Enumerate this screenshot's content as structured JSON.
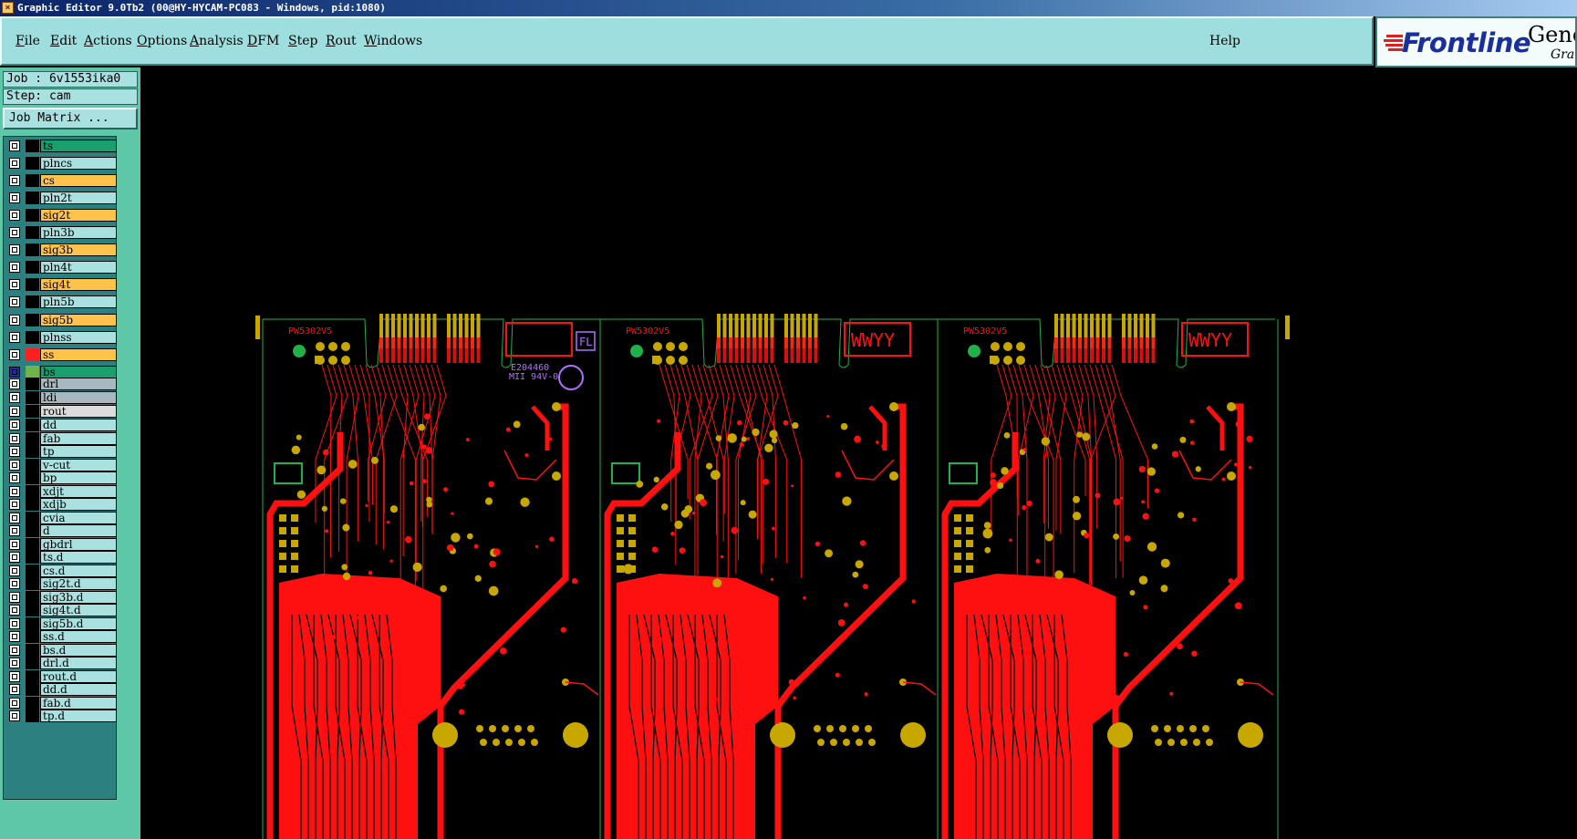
{
  "window": {
    "title": "Graphic Editor 9.0Tb2 (00@HY-HYCAM-PC083 - Windows, pid:1080)",
    "app_icon": "genesis-app-icon"
  },
  "menubar": {
    "items": [
      {
        "mnemonic": "F",
        "rest": "ile"
      },
      {
        "mnemonic": "E",
        "rest": "dit"
      },
      {
        "mnemonic": "A",
        "rest": "ctions"
      },
      {
        "mnemonic": "O",
        "rest": "ptions"
      },
      {
        "mnemonic": "A",
        "rest": "nalysis"
      },
      {
        "mnemonic": "D",
        "rest": "FM"
      },
      {
        "mnemonic": "S",
        "rest": "tep"
      },
      {
        "mnemonic": "R",
        "rest": "out"
      },
      {
        "mnemonic": "W",
        "rest": "indows"
      }
    ],
    "help": "Help"
  },
  "logo": {
    "brand": "Frontline",
    "product": "Gene",
    "subtitle": "Grap"
  },
  "job": {
    "job_label": "Job : 6v1553ika0",
    "step_label": "Step: cam",
    "job_matrix_button": "Job Matrix ..."
  },
  "layers": [
    {
      "name": "ts",
      "color": "#1aa06e",
      "swatch": "#000"
    },
    {
      "name": "plncs",
      "color": "#a9e0e0",
      "swatch": "#000"
    },
    {
      "name": "cs",
      "color": "#ffc24a",
      "swatch": "#000"
    },
    {
      "name": "pln2t",
      "color": "#a9e0e0",
      "swatch": "#000"
    },
    {
      "name": "sig2t",
      "color": "#ffc24a",
      "swatch": "#000"
    },
    {
      "name": "pln3b",
      "color": "#a9e0e0",
      "swatch": "#000"
    },
    {
      "name": "sig3b",
      "color": "#ffc24a",
      "swatch": "#000"
    },
    {
      "name": "pln4t",
      "color": "#a9e0e0",
      "swatch": "#000"
    },
    {
      "name": "sig4t",
      "color": "#ffc24a",
      "swatch": "#000"
    },
    {
      "name": "pln5b",
      "color": "#a9e0e0",
      "swatch": "#000"
    },
    {
      "name": "sig5b",
      "color": "#ffc24a",
      "swatch": "#000"
    },
    {
      "name": "plnss",
      "color": "#a9e0e0",
      "swatch": "#000"
    },
    {
      "name": "ss",
      "color": "#ffc24a",
      "swatch": "#ff2020"
    },
    {
      "name": "bs",
      "color": "#1aa06e",
      "swatch": "#6fb44a",
      "active": true
    },
    {
      "name": "drl",
      "color": "#a8b8c0",
      "swatch": "#000"
    },
    {
      "name": "ldi",
      "color": "#a8b8c0",
      "swatch": "#000"
    },
    {
      "name": "rout",
      "color": "#dcdcdc",
      "swatch": "#000"
    },
    {
      "name": "dd",
      "color": "#a9e0e0",
      "swatch": "#000"
    },
    {
      "name": "fab",
      "color": "#a9e0e0",
      "swatch": "#000"
    },
    {
      "name": "tp",
      "color": "#a9e0e0",
      "swatch": "#000"
    },
    {
      "name": "v-cut",
      "color": "#a9e0e0",
      "swatch": "#000"
    },
    {
      "name": "bp",
      "color": "#a9e0e0",
      "swatch": "#000"
    },
    {
      "name": "xdjt",
      "color": "#a9e0e0",
      "swatch": "#000"
    },
    {
      "name": "xdjb",
      "color": "#a9e0e0",
      "swatch": "#000"
    },
    {
      "name": "cvia",
      "color": "#a9e0e0",
      "swatch": "#000"
    },
    {
      "name": "d",
      "color": "#a9e0e0",
      "swatch": "#000"
    },
    {
      "name": "gbdrl",
      "color": "#a9e0e0",
      "swatch": "#000"
    },
    {
      "name": "ts.d",
      "color": "#a9e0e0",
      "swatch": "#000"
    },
    {
      "name": "cs.d",
      "color": "#a9e0e0",
      "swatch": "#000"
    },
    {
      "name": "sig2t.d",
      "color": "#a9e0e0",
      "swatch": "#000"
    },
    {
      "name": "sig3b.d",
      "color": "#a9e0e0",
      "swatch": "#000"
    },
    {
      "name": "sig4t.d",
      "color": "#a9e0e0",
      "swatch": "#000"
    },
    {
      "name": "sig5b.d",
      "color": "#a9e0e0",
      "swatch": "#000"
    },
    {
      "name": "ss.d",
      "color": "#a9e0e0",
      "swatch": "#000"
    },
    {
      "name": "bs.d",
      "color": "#a9e0e0",
      "swatch": "#000"
    },
    {
      "name": "drl.d",
      "color": "#a9e0e0",
      "swatch": "#000"
    },
    {
      "name": "rout.d",
      "color": "#a9e0e0",
      "swatch": "#000"
    },
    {
      "name": "dd.d",
      "color": "#a9e0e0",
      "swatch": "#000"
    },
    {
      "name": "fab.d",
      "color": "#a9e0e0",
      "swatch": "#000"
    },
    {
      "name": "tp.d",
      "color": "#a9e0e0",
      "swatch": "#000"
    }
  ],
  "board": {
    "part_label": "PW5302V5",
    "date_code": "WWYY",
    "panel_marking_1": "E204460",
    "panel_marking_2": "MII 94V-0",
    "corner_mark": "FL",
    "colors": {
      "outline": "#21b04a",
      "copper": "#ff1010",
      "pad": "#c8a800",
      "marking": "#b070ff",
      "background": "#000000"
    }
  }
}
